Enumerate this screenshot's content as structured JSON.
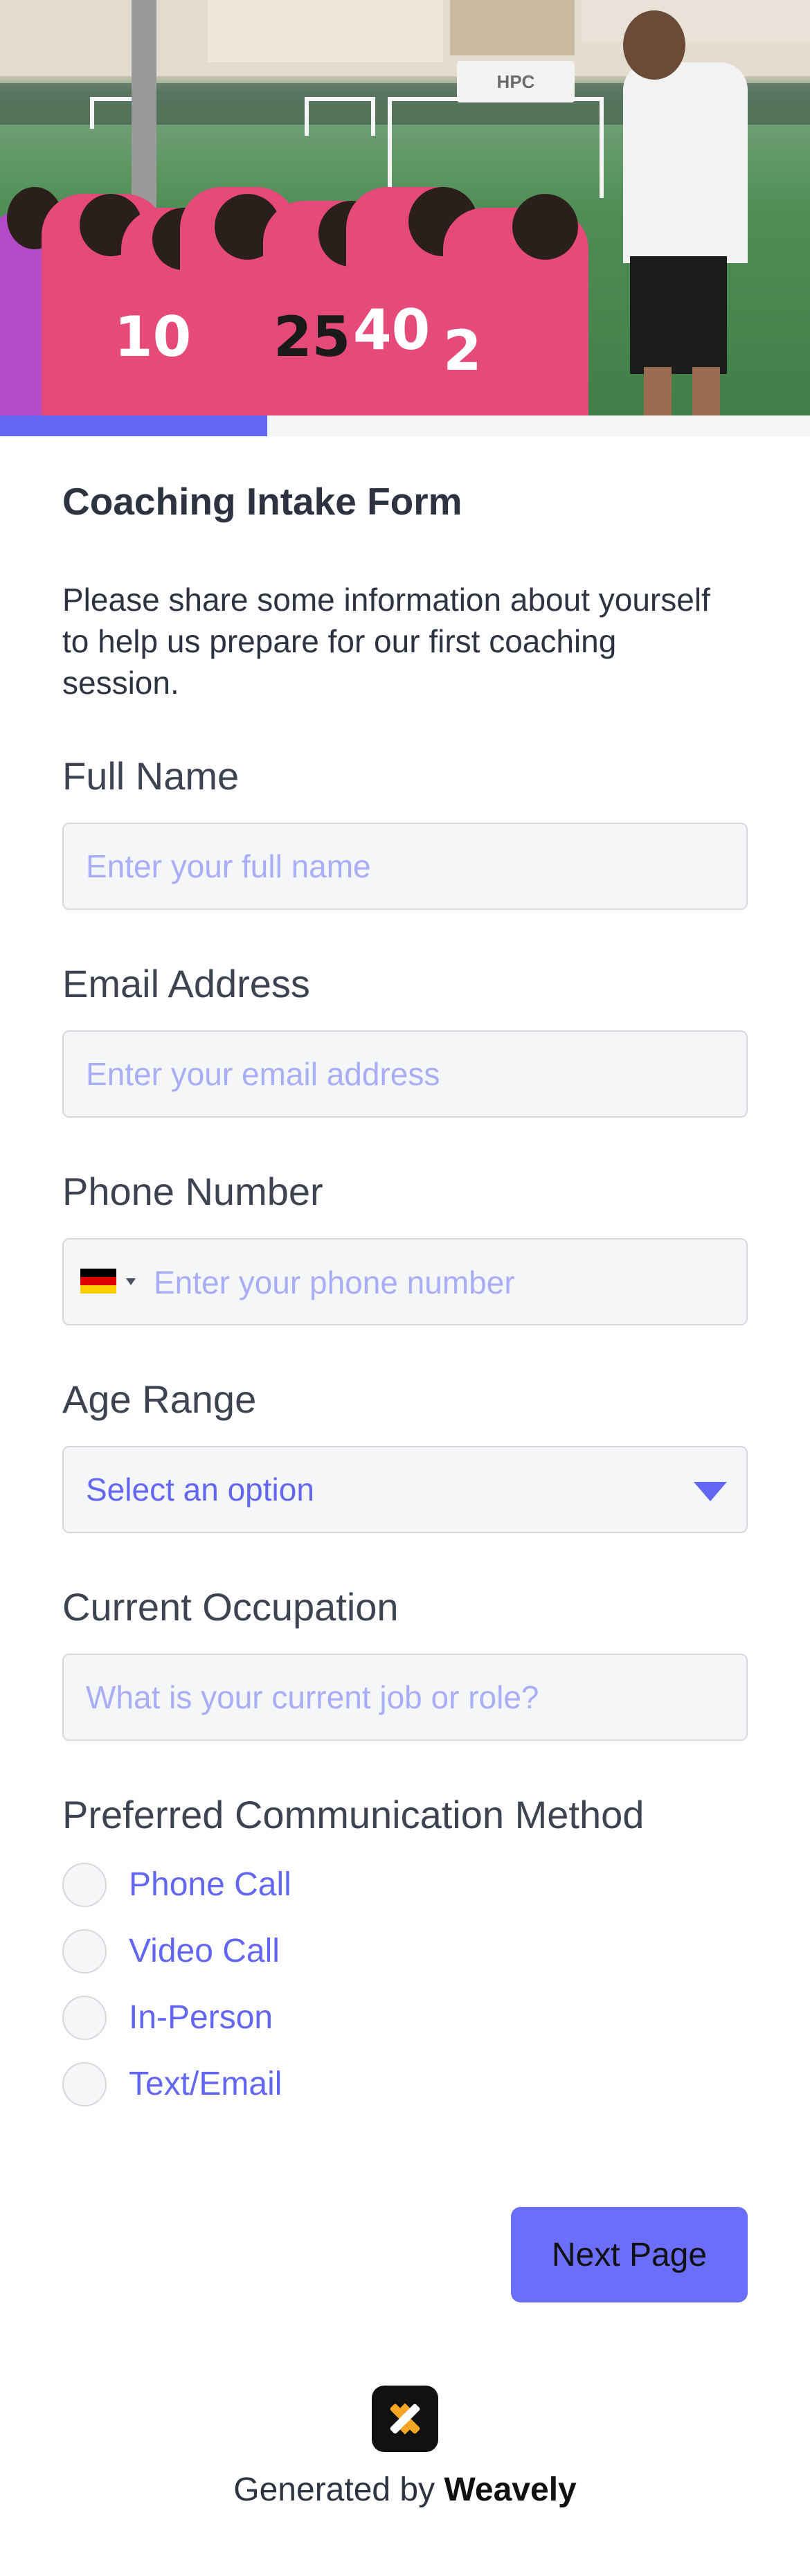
{
  "hero": {
    "banner_text": "HPC",
    "jersey_numbers": [
      "10",
      "25",
      "40",
      "2"
    ],
    "alt": "hero-photo"
  },
  "progress": {
    "fraction": 0.33
  },
  "form": {
    "title": "Coaching Intake Form",
    "description": "Please share some information about yourself to help us prepare for our first coaching session.",
    "fields": {
      "full_name": {
        "label": "Full Name",
        "placeholder": "Enter your full name",
        "value": ""
      },
      "email": {
        "label": "Email Address",
        "placeholder": "Enter your email address",
        "value": ""
      },
      "phone": {
        "label": "Phone Number",
        "placeholder": "Enter your phone number",
        "value": "",
        "country_flag": "germany-flag-icon"
      },
      "age_range": {
        "label": "Age Range",
        "selected": "Select an option"
      },
      "occupation": {
        "label": "Current Occupation",
        "placeholder": "What is your current job or role?",
        "value": ""
      },
      "communication": {
        "label": "Preferred Communication Method",
        "options": [
          "Phone Call",
          "Video Call",
          "In-Person",
          "Text/Email"
        ]
      }
    },
    "next_label": "Next Page"
  },
  "footer": {
    "prefix": "Generated by",
    "brand": "Weavely"
  },
  "colors": {
    "accent": "#6366f1",
    "button": "#6b6ef8",
    "placeholder": "#a9adf5"
  }
}
